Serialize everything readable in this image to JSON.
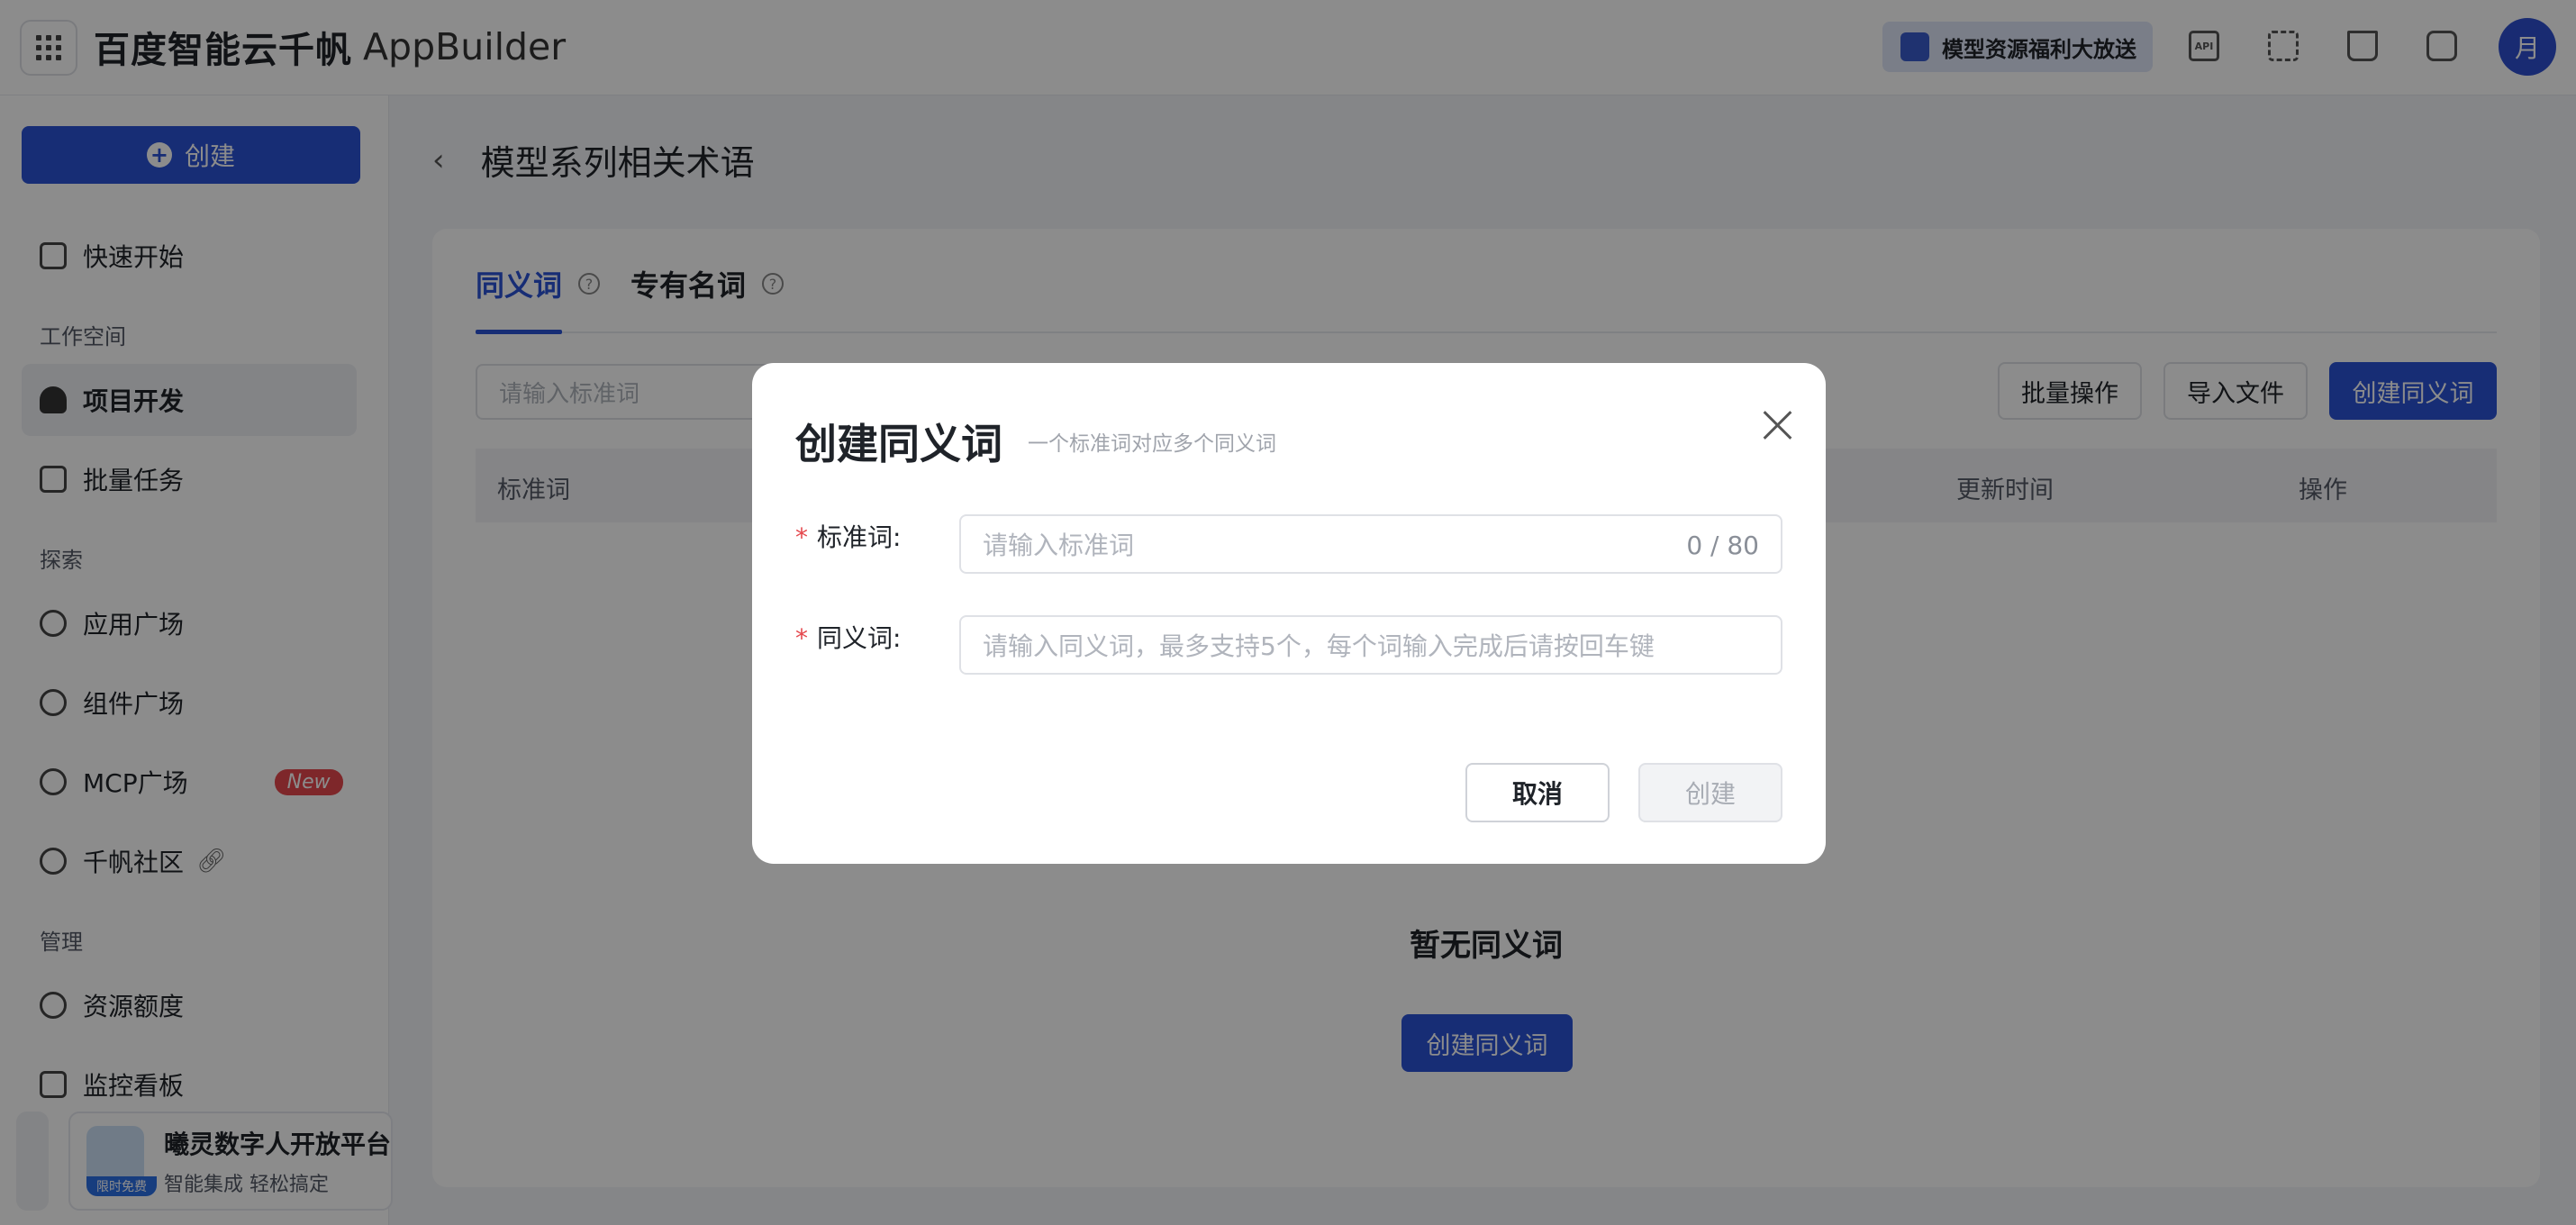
{
  "header": {
    "brand_cn": "百度智能云千帆",
    "brand_en": "AppBuilder",
    "promo_label": "模型资源福利大放送",
    "icons": [
      "apps-grid-icon",
      "api-icon",
      "qrcode-icon",
      "book-icon",
      "message-icon"
    ],
    "api_icon_text": "API",
    "avatar_letter": "月"
  },
  "sidebar": {
    "create_label": "创建",
    "quick_start": "快速开始",
    "sections": {
      "workspace": "工作空间",
      "explore": "探索",
      "manage": "管理"
    },
    "items": {
      "project_dev": "项目开发",
      "batch_tasks": "批量任务",
      "app_square": "应用广场",
      "component_square": "组件广场",
      "mcp_square": "MCP广场",
      "mcp_badge": "New",
      "community": "千帆社区",
      "resource_quota": "资源额度",
      "monitor_board": "监控看板"
    },
    "promo_card": {
      "tag": "限时免费",
      "title": "曦灵数字人开放平台",
      "subtitle": "智能集成 轻松搞定"
    }
  },
  "main": {
    "page_title": "模型系列相关术语",
    "tabs": [
      {
        "label": "同义词",
        "active": true
      },
      {
        "label": "专有名词",
        "active": false
      }
    ],
    "search_placeholder": "请输入标准词",
    "toolbar": {
      "batch": "批量操作",
      "import": "导入文件",
      "create": "创建同义词"
    },
    "table_headers": [
      "标准词",
      "更新时间",
      "操作"
    ],
    "empty_text": "暂无同义词",
    "empty_button": "创建同义词"
  },
  "modal": {
    "title": "创建同义词",
    "subtitle": "一个标准词对应多个同义词",
    "fields": {
      "standard": {
        "required_mark": "*",
        "label": "标准词:",
        "placeholder": "请输入标准词",
        "counter": "0 / 80"
      },
      "synonyms": {
        "required_mark": "*",
        "label": "同义词:",
        "placeholder": "请输入同义词，最多支持5个，每个词输入完成后请按回车键"
      }
    },
    "cancel_label": "取消",
    "submit_label": "创建"
  },
  "colors": {
    "primary": "#2b53d6",
    "danger": "#e5484d",
    "overlay": "rgba(0,0,0,0.45)"
  }
}
